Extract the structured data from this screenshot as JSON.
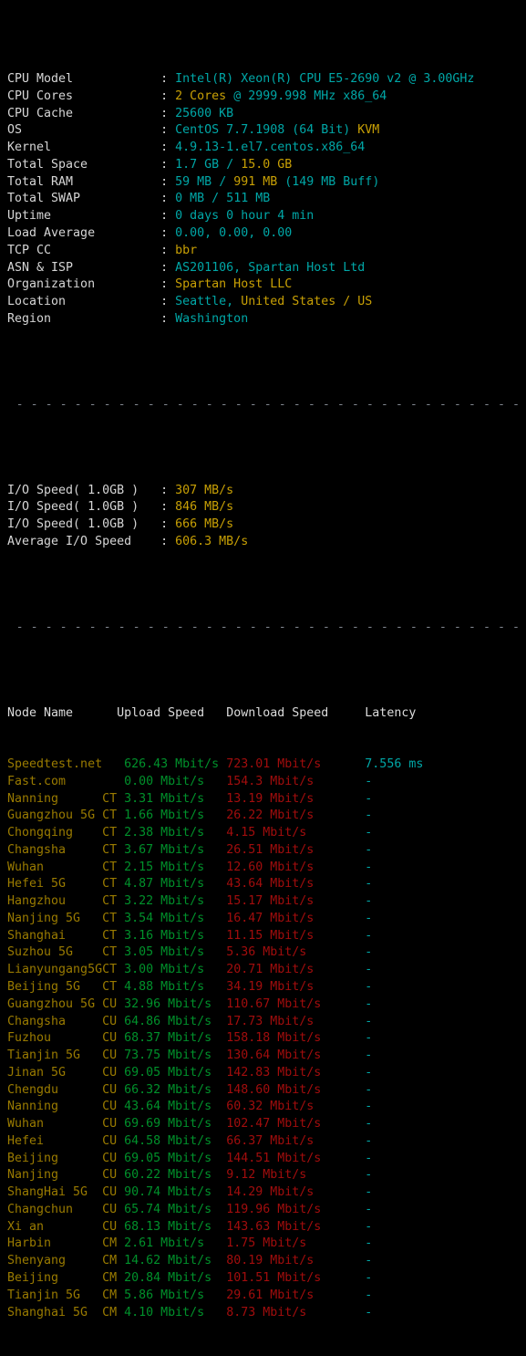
{
  "terminal": {
    "background": "#000000",
    "palette": {
      "label": "#d6d6d6",
      "cyan": "#00a7a7",
      "gold": "#c8a005",
      "olive": "#9a7b00",
      "green": "#00912b",
      "red": "#a10d0d",
      "separator": "#8a8f98"
    }
  },
  "system_info": {
    "rows": [
      {
        "label": "CPU Model",
        "sep": ":",
        "value": "Intel(R) Xeon(R) CPU E5-2690 v2 @ 3.00GHz"
      },
      {
        "label": "CPU Cores",
        "sep": ":",
        "value": "2 Cores @ 2999.998 MHz x86_64"
      },
      {
        "label": "CPU Cache",
        "sep": ":",
        "value": "25600 KB"
      },
      {
        "label": "OS",
        "sep": ":",
        "value": "CentOS 7.7.1908 (64 Bit) KVM"
      },
      {
        "label": "Kernel",
        "sep": ":",
        "value": "4.9.13-1.el7.centos.x86_64"
      },
      {
        "label": "Total Space",
        "sep": ":",
        "value": "1.7 GB / 15.0 GB"
      },
      {
        "label": "Total RAM",
        "sep": ":",
        "value": "59 MB / 991 MB (149 MB Buff)"
      },
      {
        "label": "Total SWAP",
        "sep": ":",
        "value": "0 MB / 511 MB"
      },
      {
        "label": "Uptime",
        "sep": ":",
        "value": "0 days 0 hour 4 min"
      },
      {
        "label": "Load Average",
        "sep": ":",
        "value": "0.00, 0.00, 0.00"
      },
      {
        "label": "TCP CC",
        "sep": ":",
        "value": "bbr"
      },
      {
        "label": "ASN & ISP",
        "sep": ":",
        "value": "AS201106, Spartan Host Ltd"
      },
      {
        "label": "Organization",
        "sep": ":",
        "value": "Spartan Host LLC"
      },
      {
        "label": "Location",
        "sep": ":",
        "value": "Seattle, United States / US"
      },
      {
        "label": "Region",
        "sep": ":",
        "value": "Washington"
      }
    ],
    "segments": {
      "cpu_model": [
        {
          "t": "Intel(R) Xeon(R) CPU E5-2690 v2 @ 3.00GHz",
          "c": "c-cyan"
        }
      ],
      "cpu_cores": [
        {
          "t": "2 Cores ",
          "c": "c-gold"
        },
        {
          "t": "@ 2999.998 MHz x86_64",
          "c": "c-cyan"
        }
      ],
      "cpu_cache": [
        {
          "t": "25600 KB",
          "c": "c-cyan"
        }
      ],
      "os": [
        {
          "t": "CentOS 7.7.1908 (64 Bit) ",
          "c": "c-cyan"
        },
        {
          "t": "KVM",
          "c": "c-gold"
        }
      ],
      "kernel": [
        {
          "t": "4.9.13-1.el7.centos.x86_64",
          "c": "c-cyan"
        }
      ],
      "total_space": [
        {
          "t": "1.7 GB ",
          "c": "c-cyan"
        },
        {
          "t": "/ ",
          "c": "c-cyan"
        },
        {
          "t": "15.0 GB",
          "c": "c-gold"
        }
      ],
      "total_ram": [
        {
          "t": "59 MB ",
          "c": "c-cyan"
        },
        {
          "t": "/ ",
          "c": "c-cyan"
        },
        {
          "t": "991 MB ",
          "c": "c-gold"
        },
        {
          "t": "(149 MB Buff)",
          "c": "c-cyan"
        }
      ],
      "total_swap": [
        {
          "t": "0 MB ",
          "c": "c-cyan"
        },
        {
          "t": "/ ",
          "c": "c-cyan"
        },
        {
          "t": "511 MB",
          "c": "c-cyan"
        }
      ],
      "uptime": [
        {
          "t": "0 days 0 hour 4 min",
          "c": "c-cyan"
        }
      ],
      "load": [
        {
          "t": "0.00, 0.00, 0.00",
          "c": "c-cyan"
        }
      ],
      "tcp_cc": [
        {
          "t": "bbr",
          "c": "c-gold"
        }
      ],
      "asn_isp": [
        {
          "t": "AS201106, Spartan Host Ltd",
          "c": "c-cyan"
        }
      ],
      "organization": [
        {
          "t": "Spartan Host LLC",
          "c": "c-gold"
        }
      ],
      "location": [
        {
          "t": "Seattle, ",
          "c": "c-cyan"
        },
        {
          "t": "United States / US",
          "c": "c-gold"
        }
      ],
      "region": [
        {
          "t": "Washington",
          "c": "c-cyan"
        }
      ]
    }
  },
  "io_test": {
    "rows": [
      {
        "label": "I/O Speed( 1.0GB )",
        "sep": ":",
        "value": "307 MB/s"
      },
      {
        "label": "I/O Speed( 1.0GB )",
        "sep": ":",
        "value": "846 MB/s"
      },
      {
        "label": "I/O Speed( 1.0GB )",
        "sep": ":",
        "value": "666 MB/s"
      },
      {
        "label": "Average I/O Speed",
        "sep": ":",
        "value": "606.3 MB/s"
      }
    ]
  },
  "speedtest": {
    "headers": {
      "node": "Node Name",
      "upload": "Upload Speed",
      "download": "Download Speed",
      "latency": "Latency"
    },
    "rows": [
      {
        "node": "Speedtest.net",
        "isp": "",
        "upload": "626.43 Mbit/s",
        "download": "723.01 Mbit/s",
        "latency": "7.556 ms"
      },
      {
        "node": "Fast.com",
        "isp": "",
        "upload": "0.00 Mbit/s",
        "download": "154.3 Mbit/s",
        "latency": "-"
      },
      {
        "node": "Nanning",
        "isp": "CT",
        "upload": "3.31 Mbit/s",
        "download": "13.19 Mbit/s",
        "latency": "-"
      },
      {
        "node": "Guangzhou 5G",
        "isp": "CT",
        "upload": "1.66 Mbit/s",
        "download": "26.22 Mbit/s",
        "latency": "-"
      },
      {
        "node": "Chongqing",
        "isp": "CT",
        "upload": "2.38 Mbit/s",
        "download": "4.15 Mbit/s",
        "latency": "-"
      },
      {
        "node": "Changsha",
        "isp": "CT",
        "upload": "3.67 Mbit/s",
        "download": "26.51 Mbit/s",
        "latency": "-"
      },
      {
        "node": "Wuhan",
        "isp": "CT",
        "upload": "2.15 Mbit/s",
        "download": "12.60 Mbit/s",
        "latency": "-"
      },
      {
        "node": "Hefei 5G",
        "isp": "CT",
        "upload": "4.87 Mbit/s",
        "download": "43.64 Mbit/s",
        "latency": "-"
      },
      {
        "node": "Hangzhou",
        "isp": "CT",
        "upload": "3.22 Mbit/s",
        "download": "15.17 Mbit/s",
        "latency": "-"
      },
      {
        "node": "Nanjing 5G",
        "isp": "CT",
        "upload": "3.54 Mbit/s",
        "download": "16.47 Mbit/s",
        "latency": "-"
      },
      {
        "node": "Shanghai",
        "isp": "CT",
        "upload": "3.16 Mbit/s",
        "download": "11.15 Mbit/s",
        "latency": "-"
      },
      {
        "node": "Suzhou 5G",
        "isp": "CT",
        "upload": "3.05 Mbit/s",
        "download": "5.36 Mbit/s",
        "latency": "-"
      },
      {
        "node": "Lianyungang5G",
        "isp": "CT",
        "upload": "3.00 Mbit/s",
        "download": "20.71 Mbit/s",
        "latency": "-"
      },
      {
        "node": "Beijing 5G",
        "isp": "CT",
        "upload": "4.88 Mbit/s",
        "download": "34.19 Mbit/s",
        "latency": "-"
      },
      {
        "node": "Guangzhou 5G",
        "isp": "CU",
        "upload": "32.96 Mbit/s",
        "download": "110.67 Mbit/s",
        "latency": "-"
      },
      {
        "node": "Changsha",
        "isp": "CU",
        "upload": "64.86 Mbit/s",
        "download": "17.73 Mbit/s",
        "latency": "-"
      },
      {
        "node": "Fuzhou",
        "isp": "CU",
        "upload": "68.37 Mbit/s",
        "download": "158.18 Mbit/s",
        "latency": "-"
      },
      {
        "node": "Tianjin 5G",
        "isp": "CU",
        "upload": "73.75 Mbit/s",
        "download": "130.64 Mbit/s",
        "latency": "-"
      },
      {
        "node": "Jinan 5G",
        "isp": "CU",
        "upload": "69.05 Mbit/s",
        "download": "142.83 Mbit/s",
        "latency": "-"
      },
      {
        "node": "Chengdu",
        "isp": "CU",
        "upload": "66.32 Mbit/s",
        "download": "148.60 Mbit/s",
        "latency": "-"
      },
      {
        "node": "Nanning",
        "isp": "CU",
        "upload": "43.64 Mbit/s",
        "download": "60.32 Mbit/s",
        "latency": "-"
      },
      {
        "node": "Wuhan",
        "isp": "CU",
        "upload": "69.69 Mbit/s",
        "download": "102.47 Mbit/s",
        "latency": "-"
      },
      {
        "node": "Hefei",
        "isp": "CU",
        "upload": "64.58 Mbit/s",
        "download": "66.37 Mbit/s",
        "latency": "-"
      },
      {
        "node": "Beijing",
        "isp": "CU",
        "upload": "69.05 Mbit/s",
        "download": "144.51 Mbit/s",
        "latency": "-"
      },
      {
        "node": "Nanjing",
        "isp": "CU",
        "upload": "60.22 Mbit/s",
        "download": "9.12 Mbit/s",
        "latency": "-"
      },
      {
        "node": "ShangHai 5G",
        "isp": "CU",
        "upload": "90.74 Mbit/s",
        "download": "14.29 Mbit/s",
        "latency": "-"
      },
      {
        "node": "Changchun",
        "isp": "CU",
        "upload": "65.74 Mbit/s",
        "download": "119.96 Mbit/s",
        "latency": "-"
      },
      {
        "node": "Xi an",
        "isp": "CU",
        "upload": "68.13 Mbit/s",
        "download": "143.63 Mbit/s",
        "latency": "-"
      },
      {
        "node": "Harbin",
        "isp": "CM",
        "upload": "2.61 Mbit/s",
        "download": "1.75 Mbit/s",
        "latency": "-"
      },
      {
        "node": "Shenyang",
        "isp": "CM",
        "upload": "14.62 Mbit/s",
        "download": "80.19 Mbit/s",
        "latency": "-"
      },
      {
        "node": "Beijing",
        "isp": "CM",
        "upload": "20.84 Mbit/s",
        "download": "101.51 Mbit/s",
        "latency": "-"
      },
      {
        "node": "Tianjin 5G",
        "isp": "CM",
        "upload": "5.86 Mbit/s",
        "download": "29.61 Mbit/s",
        "latency": "-"
      },
      {
        "node": "Shanghai 5G",
        "isp": "CM",
        "upload": "4.10 Mbit/s",
        "download": "8.73 Mbit/s",
        "latency": "-"
      }
    ]
  },
  "separators": {
    "dash_char": "-",
    "count": 60
  }
}
